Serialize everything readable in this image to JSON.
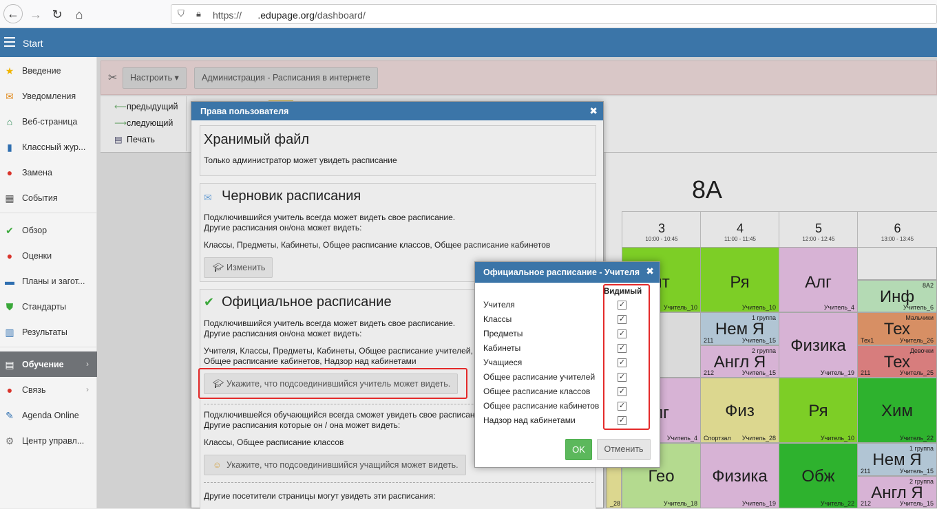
{
  "browser": {
    "url_prefix": "https://",
    "url_domain": ".edupage.org",
    "url_path": "/dashboard/"
  },
  "topbar": {
    "title": "Start"
  },
  "sidebar": {
    "items": [
      {
        "label": "Введение",
        "icon": "star-icon"
      },
      {
        "label": "Уведомления",
        "icon": "envelope-icon"
      },
      {
        "label": "Веб-страница",
        "icon": "home-icon"
      },
      {
        "label": "Классный жур...",
        "icon": "journal-icon"
      },
      {
        "label": "Замена",
        "icon": "substitution-icon"
      },
      {
        "label": "События",
        "icon": "calendar-icon"
      },
      {
        "label": "Обзор",
        "icon": "check-circle-icon"
      },
      {
        "label": "Оценки",
        "icon": "grades-icon"
      },
      {
        "label": "Планы и загот...",
        "icon": "briefcase-icon"
      },
      {
        "label": "Стандарты",
        "icon": "shield-icon"
      },
      {
        "label": "Результаты",
        "icon": "bar-chart-icon"
      },
      {
        "label": "Обучение",
        "icon": "book-icon"
      },
      {
        "label": "Связь",
        "icon": "chat-icon"
      },
      {
        "label": "Agenda Online",
        "icon": "pen-icon"
      },
      {
        "label": "Центр управл...",
        "icon": "gear-icon"
      }
    ]
  },
  "toolbar": {
    "configure_label": "Настроить ▾",
    "admin_label": "Администрация - Расписания в интернете"
  },
  "nav": {
    "prev": "предыдущий",
    "next": "следующий",
    "print": "Печать"
  },
  "timetable": {
    "title": "8A",
    "periods": [
      {
        "num": "3",
        "time": "10:00 - 10:45"
      },
      {
        "num": "4",
        "time": "11:00 - 11:45"
      },
      {
        "num": "5",
        "time": "12:00 - 12:45"
      },
      {
        "num": "6",
        "time": "13:00 - 13:45"
      }
    ],
    "cells": [
      {
        "subject": "ит",
        "teacher": "Учитель_10",
        "room": "",
        "group": "",
        "color": "#8ce62b"
      },
      {
        "subject": "Ря",
        "teacher": "Учитель_10",
        "room": "",
        "group": "",
        "color": "#8ce62b"
      },
      {
        "subject": "Алг",
        "teacher": "Учитель_4",
        "room": "",
        "group": "",
        "color": "#f0c8ee"
      },
      {
        "subject": "Инф",
        "teacher": "Учитель_6",
        "room": "",
        "group": "8A2",
        "color": "#c9f3c9"
      },
      {
        "subject": "Нем Я",
        "teacher": "Учитель_15",
        "room": "211",
        "group": "1 группа",
        "color": "#c6dced"
      },
      {
        "subject": "Англ Я",
        "teacher": "Учитель_15",
        "room": "212",
        "group": "2 группа",
        "color": "#f0c8ee"
      },
      {
        "subject": "Физика",
        "teacher": "Учитель_19",
        "room": "",
        "group": "",
        "color": "#f0c8ee"
      },
      {
        "subject": "Тех",
        "teacher": "Учитель_26",
        "room": "Тех1",
        "group": "Мальчики",
        "color": "#f0a070"
      },
      {
        "subject": "Тех",
        "teacher": "Учитель_25",
        "room": "211",
        "group": "Девочки",
        "color": "#f08c8c"
      },
      {
        "subject": "лг",
        "teacher": "Учитель_4",
        "room": "",
        "group": "",
        "color": "#f0c8ee"
      },
      {
        "subject": "Физ",
        "teacher": "Учитель_28",
        "room": "Спортзал",
        "group": "",
        "color": "#f5f0a0"
      },
      {
        "subject": "Ря",
        "teacher": "Учитель_10",
        "room": "",
        "group": "",
        "color": "#8ce62b"
      },
      {
        "subject": "Хим",
        "teacher": "Учитель_22",
        "room": "",
        "group": "",
        "color": "#34c734"
      },
      {
        "subject": "Гео",
        "teacher": "Учитель_18",
        "room": "",
        "group": "",
        "color": "#c9f3a0"
      },
      {
        "subject": "Физика",
        "teacher": "Учитель_19",
        "room": "",
        "group": "",
        "color": "#f0c8ee"
      },
      {
        "subject": "Обж",
        "teacher": "Учитель_22",
        "room": "",
        "group": "",
        "color": "#34c734"
      },
      {
        "subject": "Нем Я",
        "teacher": "Учитель_15",
        "room": "211",
        "group": "1 группа",
        "color": "#c6dced"
      },
      {
        "subject": "Англ Я",
        "teacher": "Учитель_15",
        "room": "212",
        "group": "2 группа",
        "color": "#f0c8ee"
      },
      {
        "subject": "",
        "teacher": "_28",
        "room": "",
        "group": "",
        "color": "#f5f0a0"
      }
    ]
  },
  "dialog1": {
    "title": "Права пользователя",
    "s1": {
      "title": "Хранимый файл",
      "text": "Только администратор может увидеть расписание"
    },
    "s2": {
      "title": "Черновик расписания",
      "line1": "Подключившийся учитель всегда может видеть свое расписание.",
      "line2": "Другие расписания он/она может видеть:",
      "list": "Классы, Предметы, Кабинеты, Общее расписание классов, Общее расписание кабинетов",
      "button": "Изменить"
    },
    "s3": {
      "title": "Официальное расписание",
      "line1": "Подключившийся учитель всегда может видеть свое расписание.",
      "line2": "Другие расписания он/она может видеть:",
      "list1": "Учителя, Классы, Предметы, Кабинеты, Общее расписание учителей,",
      "list2": "Общее расписание кабинетов, Надзор над кабинетами",
      "teacher_button": "Укажите, что подсоединившийся учитель может видеть.",
      "s_line1": "Подключившейся обучающийся всегда сможет увидеть свое расписание.",
      "s_line2": "Другие расписания которые он / она может видеть:",
      "s_list": "Классы, Общее расписание классов",
      "student_button": "Укажите, что подсоединившийся учащийся может видеть.",
      "visitors": "Другие посетители страницы могут увидеть эти расписания:"
    }
  },
  "dialog2": {
    "title": "Официальное расписание - Учителя",
    "column": "Видимый",
    "rows": [
      {
        "label": "Учителя",
        "checked": true
      },
      {
        "label": "Классы",
        "checked": true
      },
      {
        "label": "Предметы",
        "checked": true
      },
      {
        "label": "Кабинеты",
        "checked": true
      },
      {
        "label": "Учащиеся",
        "checked": true
      },
      {
        "label": "Общее расписание учителей",
        "checked": true
      },
      {
        "label": "Общее расписание классов",
        "checked": true
      },
      {
        "label": "Общее расписание кабинетов",
        "checked": true
      },
      {
        "label": "Надзор над кабинетами",
        "checked": true
      }
    ],
    "ok": "OK",
    "cancel": "Отменить"
  },
  "colors": {
    "brand": "#3b75a8",
    "ok": "#5cb85c",
    "highlight": "#e42a2a"
  }
}
